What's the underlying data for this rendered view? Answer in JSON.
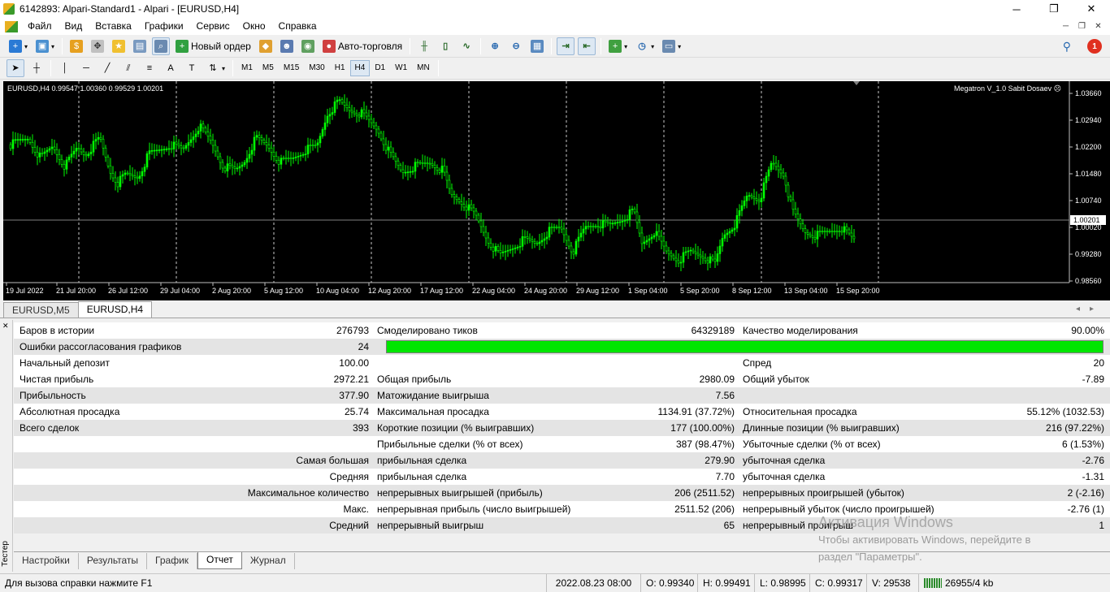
{
  "window": {
    "title": "6142893: Alpari-Standard1 - Alpari - [EURUSD,H4]",
    "minimize": "─",
    "maximize": "❐",
    "close": "✕"
  },
  "menu": [
    "Файл",
    "Вид",
    "Вставка",
    "Графики",
    "Сервис",
    "Окно",
    "Справка"
  ],
  "toolbar": {
    "new_order": "Новый ордер",
    "autotrading": "Авто-торговля",
    "notifications": "1"
  },
  "timeframes": [
    "M1",
    "M5",
    "M15",
    "M30",
    "H1",
    "H4",
    "D1",
    "W1",
    "MN"
  ],
  "active_timeframe": "H4",
  "chart": {
    "info": "EURUSD,H4  0.99547 1.00360 0.99529 1.00201",
    "expert": "Megatron V_1.0 Sabit Dosaev ☹",
    "price_labels": [
      "1.03660",
      "1.02940",
      "1.02200",
      "1.01480",
      "1.00740",
      "1.00020",
      "0.99280",
      "0.98560"
    ],
    "current_price": "1.00201",
    "date_labels": [
      "19 Jul 2022",
      "21 Jul 20:00",
      "26 Jul 12:00",
      "29 Jul 04:00",
      "2 Aug 20:00",
      "5 Aug 12:00",
      "10 Aug 04:00",
      "12 Aug 20:00",
      "17 Aug 12:00",
      "22 Aug 04:00",
      "24 Aug 20:00",
      "29 Aug 12:00",
      "1 Sep 04:00",
      "5 Sep 20:00",
      "8 Sep 12:00",
      "13 Sep 04:00",
      "15 Sep 20:00"
    ],
    "candle_color": "#00ff00",
    "background": "#000000"
  },
  "chart_tabs": [
    "EURUSD,M5",
    "EURUSD,H4"
  ],
  "chart_tabs_active": "EURUSD,H4",
  "report": {
    "row1": {
      "l1": "Баров в истории",
      "v1": "276793",
      "l2": "Смоделировано тиков",
      "v2": "64329189",
      "l3": "Качество моделирования",
      "v3": "90.00%"
    },
    "row2": {
      "l1": "Ошибки рассогласования графиков",
      "v1": "24"
    },
    "row3": {
      "l1": "Начальный депозит",
      "v1": "100.00",
      "l3": "Спред",
      "v3": "20"
    },
    "row4": {
      "l1": "Чистая прибыль",
      "v1": "2972.21",
      "l2": "Общая прибыль",
      "v2": "2980.09",
      "l3": "Общий убыток",
      "v3": "-7.89"
    },
    "row5": {
      "l1": "Прибыльность",
      "v1": "377.90",
      "l2": "Матожидание выигрыша",
      "v2": "7.56"
    },
    "row6": {
      "l1": "Абсолютная просадка",
      "v1": "25.74",
      "l2": "Максимальная просадка",
      "v2": "1134.91 (37.72%)",
      "l3": "Относительная просадка",
      "v3": "55.12% (1032.53)"
    },
    "row7": {
      "l1": "Всего сделок",
      "v1": "393",
      "l2": "Короткие позиции (% выигравших)",
      "v2": "177 (100.00%)",
      "l3": "Длинные позиции (% выигравших)",
      "v3": "216 (97.22%)"
    },
    "row8": {
      "l2": "Прибыльные сделки (% от всех)",
      "v2": "387 (98.47%)",
      "l3": "Убыточные сделки (% от всех)",
      "v3": "6 (1.53%)"
    },
    "row9": {
      "r1": "Самая большая",
      "l2": "прибыльная сделка",
      "v2": "279.90",
      "l3": "убыточная сделка",
      "v3": "-2.76"
    },
    "row10": {
      "r1": "Средняя",
      "l2": "прибыльная сделка",
      "v2": "7.70",
      "l3": "убыточная сделка",
      "v3": "-1.31"
    },
    "row11": {
      "r1": "Максимальное количество",
      "l2": "непрерывных выигрышей (прибыль)",
      "v2": "206 (2511.52)",
      "l3": "непрерывных проигрышей (убыток)",
      "v3": "2 (-2.16)"
    },
    "row12": {
      "r1": "Макс.",
      "l2": "непрерывная прибыль (число выигрышей)",
      "v2": "2511.52 (206)",
      "l3": "непрерывный убыток (число проигрышей)",
      "v3": "-2.76 (1)"
    },
    "row13": {
      "r1": "Средний",
      "l2": "непрерывный выигрыш",
      "v2": "65",
      "l3": "непрерывный проигрыш",
      "v3": "1"
    }
  },
  "tester_label": "Тестер",
  "tester_tabs": [
    "Настройки",
    "Результаты",
    "График",
    "Отчет",
    "Журнал"
  ],
  "tester_tabs_active": "Отчет",
  "status": {
    "help": "Для вызова справки нажмите F1",
    "datetime": "2022.08.23 08:00",
    "open": "O: 0.99340",
    "high": "H: 0.99491",
    "low": "L: 0.98995",
    "close": "C: 0.99317",
    "volume": "V: 29538",
    "traffic": "26955/4 kb"
  },
  "watermark": {
    "line1": "Активация Windows",
    "line2": "Чтобы активировать Windows, перейдите в",
    "line3": "раздел \"Параметры\"."
  }
}
